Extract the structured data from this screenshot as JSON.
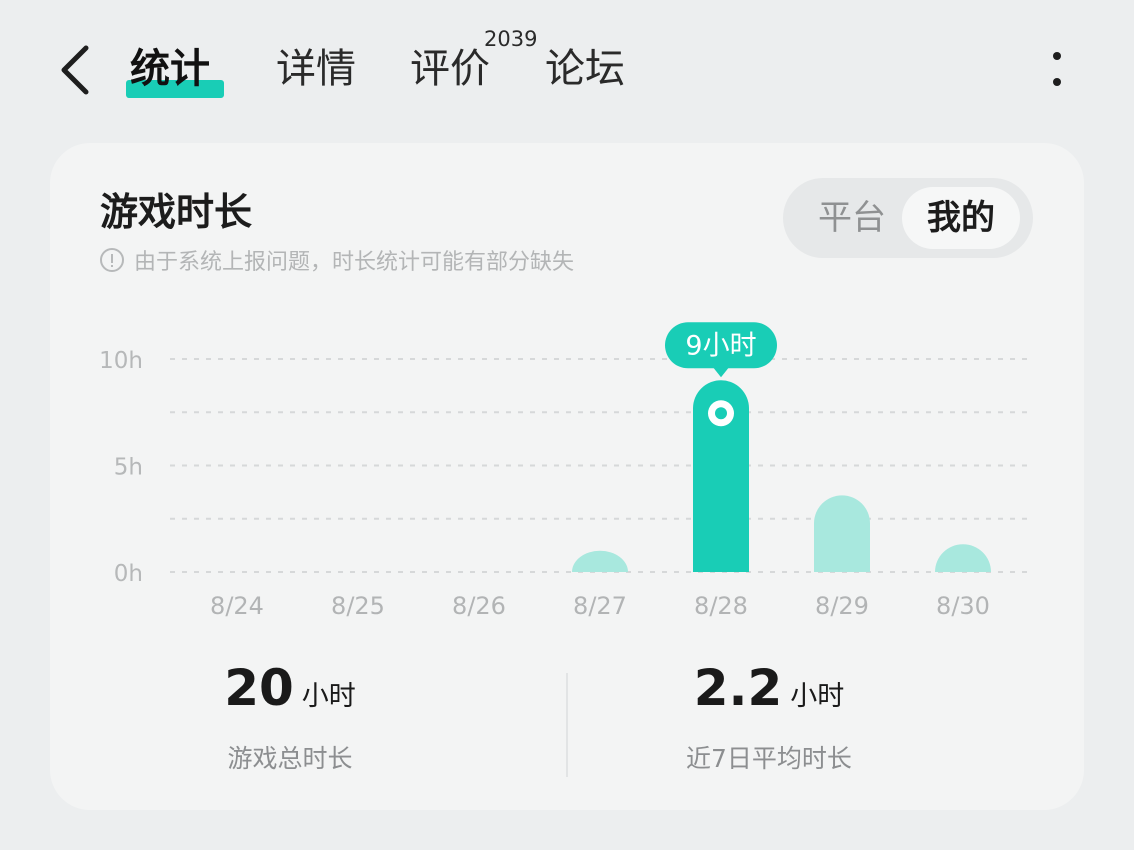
{
  "nav": {
    "tabs": [
      {
        "label": "统计",
        "active": true
      },
      {
        "label": "详情",
        "active": false
      },
      {
        "label": "评价",
        "active": false,
        "badge": "2039"
      },
      {
        "label": "论坛",
        "active": false
      }
    ]
  },
  "card": {
    "title": "游戏时长",
    "notice": "由于系统上报问题，时长统计可能有部分缺失",
    "toggle": {
      "options": [
        "平台",
        "我的"
      ],
      "selected": "我的"
    }
  },
  "stats": {
    "total_value": "20",
    "total_unit": "小时",
    "total_label": "游戏总时长",
    "avg_value": "2.2",
    "avg_unit": "小时",
    "avg_label": "近7日平均时长"
  },
  "colors": {
    "accent": "#19cdb6",
    "bar_light": "#a8e8de",
    "background": "#eceeef",
    "card": "#f3f4f4"
  },
  "chart_data": {
    "type": "bar",
    "categories": [
      "8/24",
      "8/25",
      "8/26",
      "8/27",
      "8/28",
      "8/29",
      "8/30"
    ],
    "values": [
      0,
      0,
      0,
      1,
      9,
      3.6,
      1.3
    ],
    "unit": "h",
    "ylim": [
      0,
      10
    ],
    "yticks": [
      "0h",
      "5h",
      "10h"
    ],
    "grid": true,
    "highlighted_index": 4,
    "tooltip": "9小时"
  }
}
